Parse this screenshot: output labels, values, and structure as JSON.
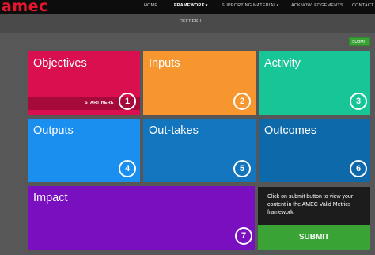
{
  "header": {
    "logo": "amec",
    "nav": [
      {
        "label": "HOME"
      },
      {
        "label": "FRAMEWORK",
        "caret": "▾"
      },
      {
        "label": "SUPPORTING MATERIAL",
        "caret": "▾"
      },
      {
        "label": "ACKNOWLEDGEMENTS"
      },
      {
        "label": "CONTACT"
      }
    ]
  },
  "toolbar": {
    "refresh_label": "REFRESH",
    "submit_small_label": "SUBMIT"
  },
  "tiles": [
    {
      "title": "Objectives",
      "number": "1",
      "color": "#d90f4f",
      "sub_label": "START HERE"
    },
    {
      "title": "Inputs",
      "number": "2",
      "color": "#f7962e"
    },
    {
      "title": "Activity",
      "number": "3",
      "color": "#17c596"
    },
    {
      "title": "Outputs",
      "number": "4",
      "color": "#1a8ff0"
    },
    {
      "title": "Out-takes",
      "number": "5",
      "color": "#1275be"
    },
    {
      "title": "Outcomes",
      "number": "6",
      "color": "#0d69aa"
    },
    {
      "title": "Impact",
      "number": "7",
      "color": "#7a0fc0"
    }
  ],
  "panel": {
    "text": "Click on submit button to view your content in the AMEC Valid Metrics framework.",
    "submit_label": "SUBMIT",
    "colors": {
      "background": "#1c1c1c",
      "button": "#3aa335"
    }
  }
}
